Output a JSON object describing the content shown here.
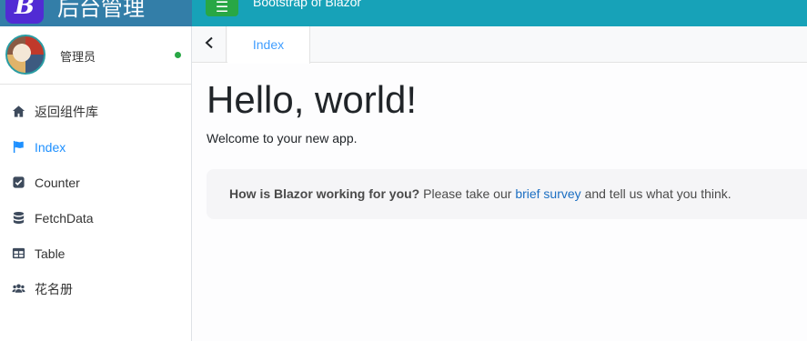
{
  "header": {
    "logo_letter": "B",
    "brand_title": "后台管理",
    "menu_icon": "hamburger-icon",
    "title": "Bootstrap of Blazor"
  },
  "user": {
    "name": "管理员",
    "status": "online",
    "status_color": "#28a745"
  },
  "sidebar": {
    "items": [
      {
        "label": "返回组件库",
        "icon": "home-icon",
        "active": false
      },
      {
        "label": "Index",
        "icon": "flag-icon",
        "active": true
      },
      {
        "label": "Counter",
        "icon": "checkbox-icon",
        "active": false
      },
      {
        "label": "FetchData",
        "icon": "database-icon",
        "active": false
      },
      {
        "label": "Table",
        "icon": "table-icon",
        "active": false
      },
      {
        "label": "花名册",
        "icon": "users-icon",
        "active": false
      }
    ]
  },
  "tabs": {
    "back_icon": "chevron-left-icon",
    "items": [
      {
        "label": "Index",
        "active": true
      }
    ]
  },
  "main": {
    "heading": "Hello, world!",
    "welcome": "Welcome to your new app.",
    "survey": {
      "question": "How is Blazor working for you?",
      "prefix": "Please take our",
      "link": "brief survey",
      "suffix": "and tell us what you think."
    }
  },
  "colors": {
    "brand_bg": "#337ea8",
    "topbar_bg": "#17a2b8",
    "toggle_bg": "#28a745",
    "active": "#1e90ff",
    "link": "#1b6ec2"
  }
}
